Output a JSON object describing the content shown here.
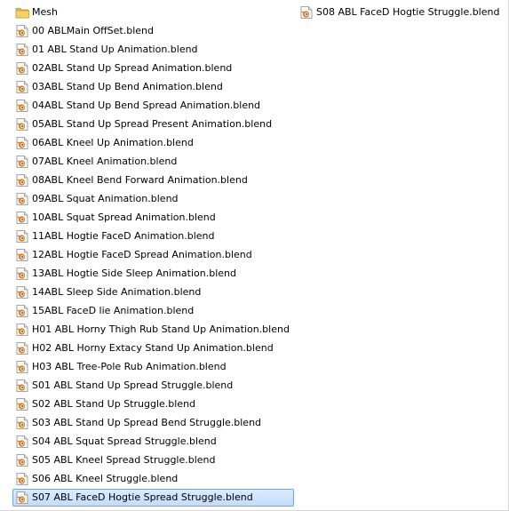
{
  "explorer": {
    "columns": [
      [
        {
          "name": "Mesh",
          "type": "folder"
        },
        {
          "name": "00 ABLMain OffSet.blend",
          "type": "blend"
        },
        {
          "name": "01 ABL Stand Up Animation.blend",
          "type": "blend"
        },
        {
          "name": "02ABL Stand Up Spread Animation.blend",
          "type": "blend"
        },
        {
          "name": "03ABL Stand Up Bend Animation.blend",
          "type": "blend"
        },
        {
          "name": "04ABL Stand Up Bend Spread Animation.blend",
          "type": "blend"
        },
        {
          "name": "05ABL Stand Up Spread  Present Animation.blend",
          "type": "blend"
        },
        {
          "name": "06ABL Kneel Up Animation.blend",
          "type": "blend"
        },
        {
          "name": "07ABL Kneel Animation.blend",
          "type": "blend"
        },
        {
          "name": "08ABL Kneel Bend Forward Animation.blend",
          "type": "blend"
        },
        {
          "name": "09ABL Squat Animation.blend",
          "type": "blend"
        },
        {
          "name": "10ABL Squat  Spread Animation.blend",
          "type": "blend"
        },
        {
          "name": "11ABL Hogtie FaceD Animation.blend",
          "type": "blend"
        },
        {
          "name": "12ABL Hogtie FaceD Spread Animation.blend",
          "type": "blend"
        },
        {
          "name": "13ABL Hogtie Side Sleep Animation.blend",
          "type": "blend"
        },
        {
          "name": "14ABL Sleep Side Animation.blend",
          "type": "blend"
        },
        {
          "name": "15ABL FaceD lie Animation.blend",
          "type": "blend"
        },
        {
          "name": "H01 ABL Horny Thigh Rub Stand Up Animation.blend",
          "type": "blend"
        },
        {
          "name": "H02 ABL Horny Extacy Stand Up Animation.blend",
          "type": "blend"
        },
        {
          "name": "H03 ABL Tree-Pole Rub Animation.blend",
          "type": "blend"
        },
        {
          "name": "S01 ABL Stand Up Spread Struggle.blend",
          "type": "blend"
        },
        {
          "name": "S02 ABL Stand Up Struggle.blend",
          "type": "blend"
        },
        {
          "name": "S03 ABL Stand Up Spread Bend Struggle.blend",
          "type": "blend"
        },
        {
          "name": "S04 ABL Squat Spread Struggle.blend",
          "type": "blend"
        },
        {
          "name": "S05 ABL Kneel Spread Struggle.blend",
          "type": "blend"
        },
        {
          "name": "S06 ABL Kneel Struggle.blend",
          "type": "blend"
        },
        {
          "name": "S07 ABL FaceD Hogtie Spread Struggle.blend",
          "type": "blend",
          "selected": true
        }
      ],
      [
        {
          "name": "S08 ABL FaceD Hogtie Struggle.blend",
          "type": "blend"
        }
      ]
    ],
    "icons": {
      "folder": "folder-icon",
      "blend": "blender-file-icon"
    },
    "colors": {
      "selection_fill": "#cce8ff",
      "selection_border": "#7da2ce",
      "folder": "#e8c35a",
      "blend_orange": "#e87d0d"
    }
  }
}
